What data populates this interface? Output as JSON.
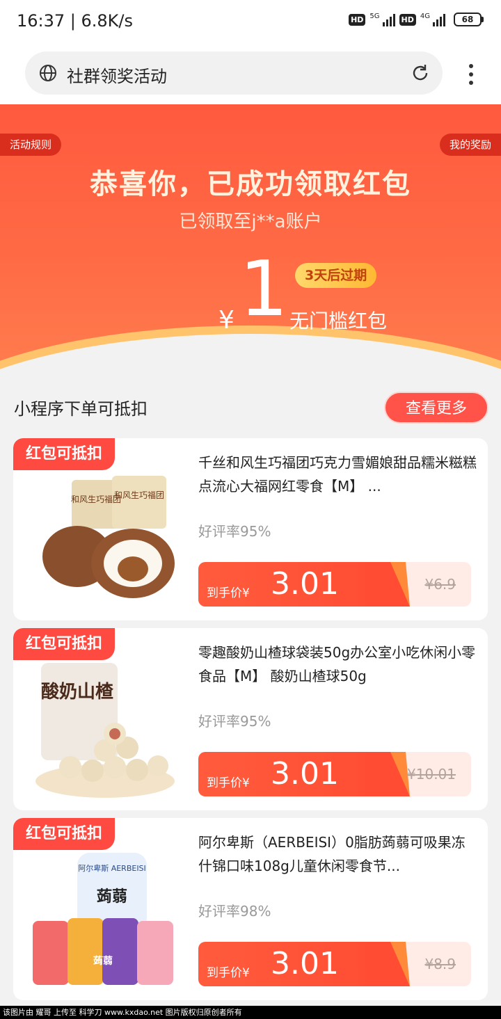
{
  "status_bar": {
    "time": "16:37 | 6.8K/s",
    "hd1": "HD",
    "gen1": "5G",
    "hd2": "HD",
    "gen2": "4G",
    "battery": "68"
  },
  "browser": {
    "page_title": "社群领奖活动"
  },
  "hero": {
    "rules_label": "活动规则",
    "my_rewards_label": "我的奖励",
    "congrats": "恭喜你，已成功领取红包",
    "account_line": "已领取至j**a账户",
    "currency": "¥",
    "amount": "1",
    "expire": "3天后过期",
    "packet_type": "无门槛红包"
  },
  "section": {
    "title": "小程序下单可抵扣",
    "more_label": "查看更多"
  },
  "products": [
    {
      "badge": "红包可抵扣",
      "name": "千丝和风生巧福团巧克力雪媚娘甜品糯米糍糕点流心大福网红零食【M】 ...",
      "rate": "好评率95%",
      "price_label": "到手价¥",
      "price": "3.01",
      "original": "¥6.9",
      "image": "chocolate-mochi-image"
    },
    {
      "badge": "红包可抵扣",
      "name": "零趣酸奶山楂球袋装50g办公室小吃休闲小零食品【M】 酸奶山楂球50g",
      "rate": "好评率95%",
      "price_label": "到手价¥",
      "price": "3.01",
      "original": "¥10.01",
      "image": "yogurt-hawthorn-balls-image"
    },
    {
      "badge": "红包可抵扣",
      "name": "阿尔卑斯（AERBEISI）0脂肪蒟蒻可吸果冻什锦口味108g儿童休闲零食节...",
      "rate": "好评率98%",
      "price_label": "到手价¥",
      "price": "3.01",
      "original": "¥8.9",
      "image": "konjac-jelly-image"
    }
  ],
  "img_text": {
    "p1_pack1": "和风生巧福团",
    "p1_pack2": "和风生巧福团",
    "p2_pack": "酸奶山楂",
    "p3_brand": "阿尔卑斯 AERBEISI",
    "p3_name": "蒟蒻",
    "p3_cups": "蒟蒻"
  },
  "footer": {
    "text": "该图片由 耀哥 上传至 科学刀 www.kxdao.net 图片版权归原创者所有"
  },
  "colors": {
    "accent": "#ff4a41",
    "hero": "#ff5a3e",
    "gold": "#ffc36b"
  }
}
